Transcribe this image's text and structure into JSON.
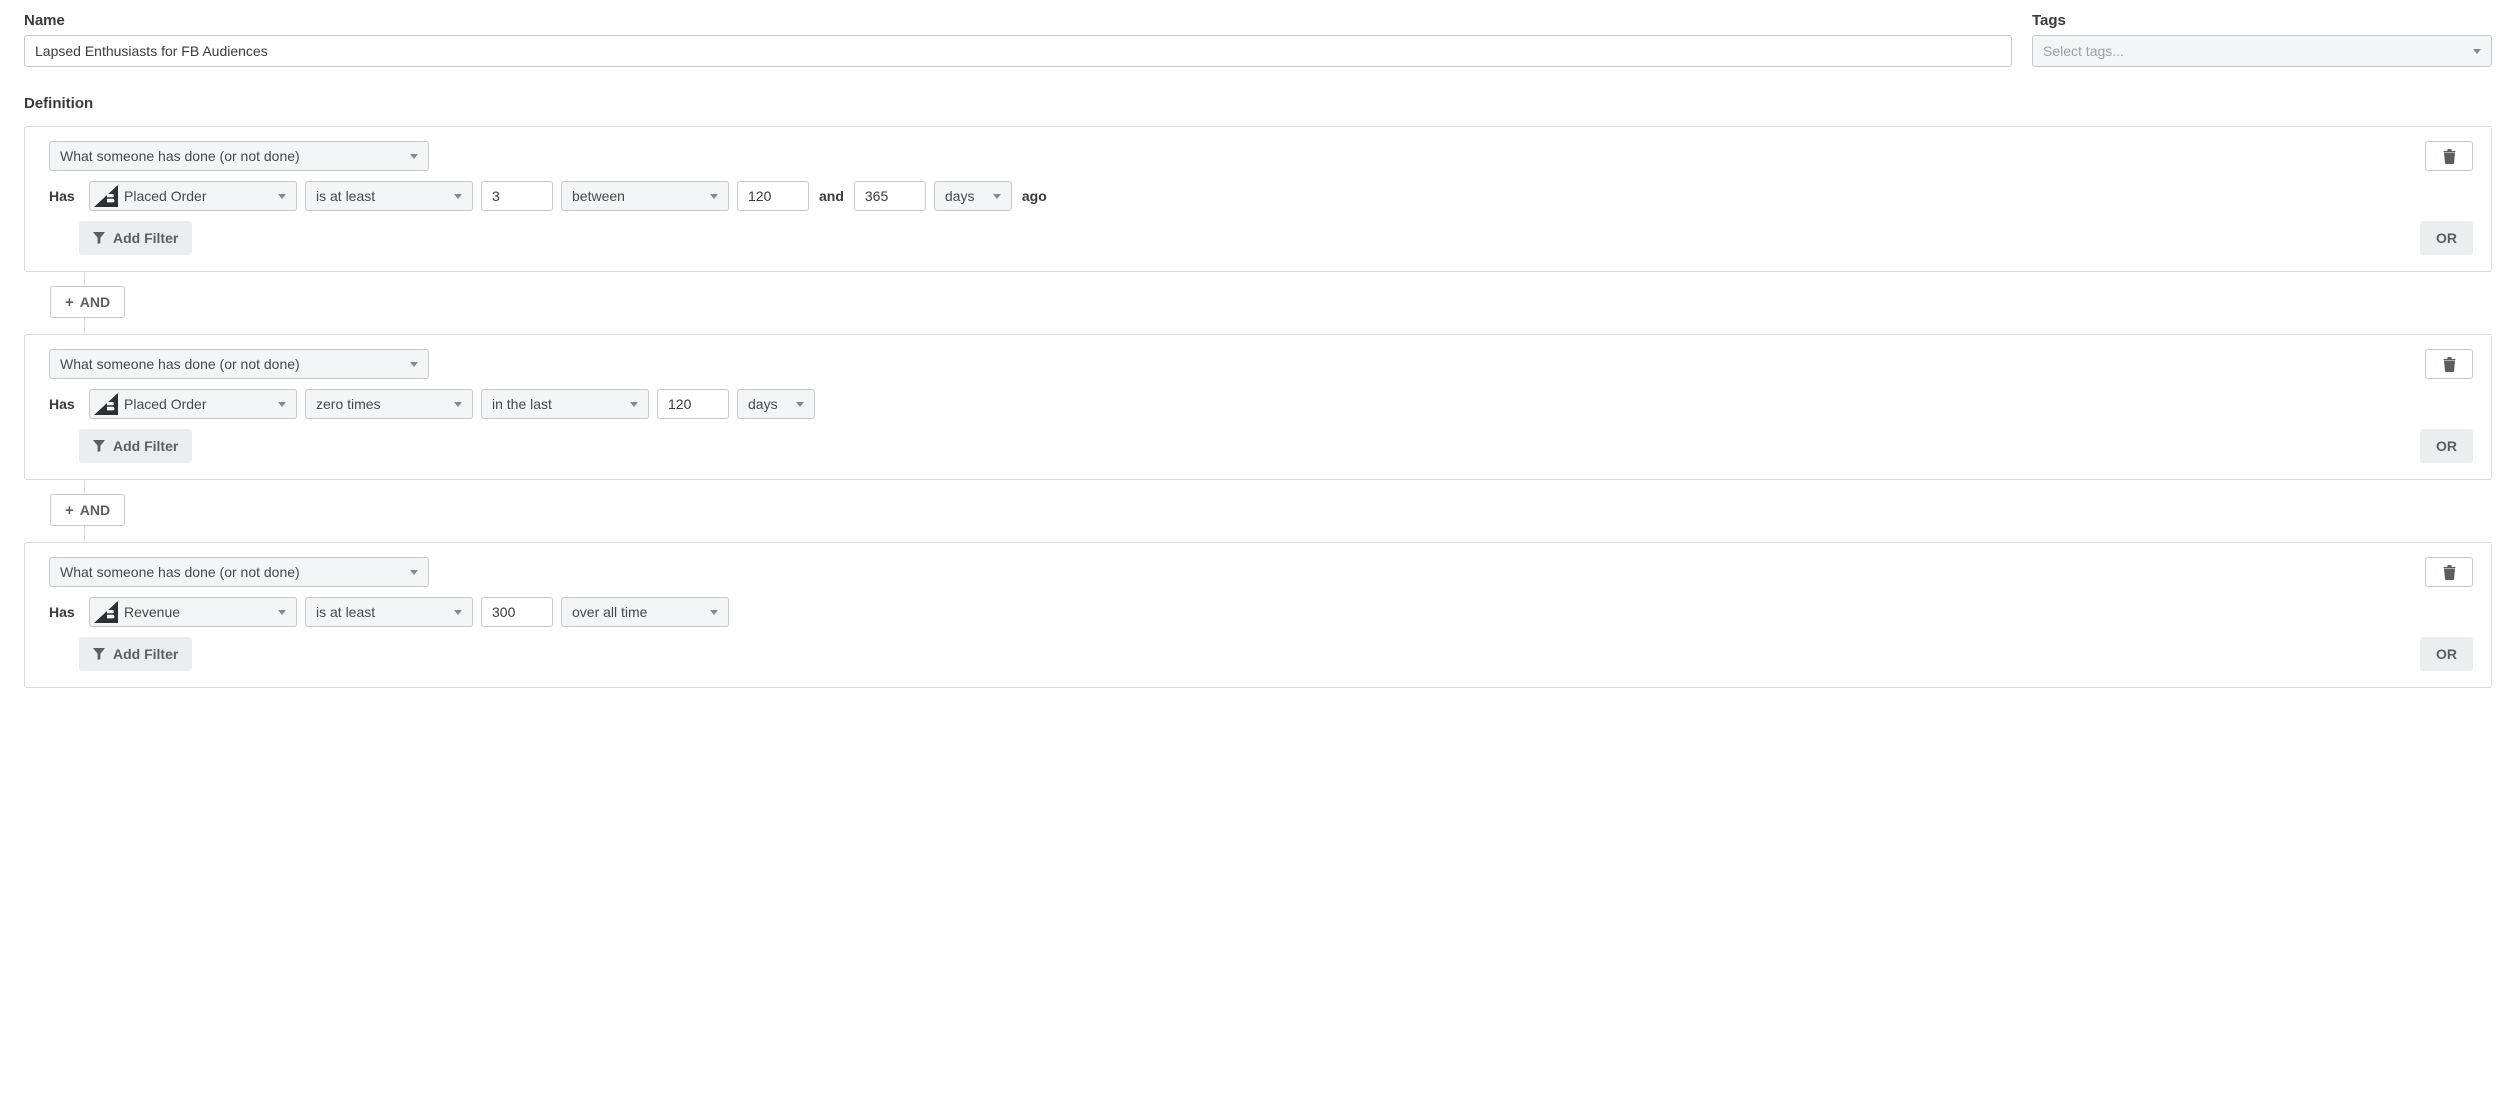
{
  "nameLabel": "Name",
  "nameValue": "Lapsed Enthusiasts for FB Audiences",
  "tagsLabel": "Tags",
  "tagsPlaceholder": "Select tags...",
  "definitionLabel": "Definition",
  "addFilterLabel": "Add Filter",
  "orLabel": "OR",
  "andLabel": "AND",
  "hasLabel": "Has",
  "andWord": "and",
  "agoWord": "ago",
  "groups": [
    {
      "conditionType": "What someone has done (or not done)",
      "metric": "Placed Order",
      "operator": "is at least",
      "count": "3",
      "timeframe": "between",
      "tfVal1": "120",
      "tfVal2": "365",
      "tfUnit": "days"
    },
    {
      "conditionType": "What someone has done (or not done)",
      "metric": "Placed Order",
      "operator": "zero times",
      "timeframe": "in the last",
      "tfVal1": "120",
      "tfUnit": "days"
    },
    {
      "conditionType": "What someone has done (or not done)",
      "metric": "Revenue",
      "operator": "is at least",
      "count": "300",
      "timeframe": "over all time"
    }
  ]
}
